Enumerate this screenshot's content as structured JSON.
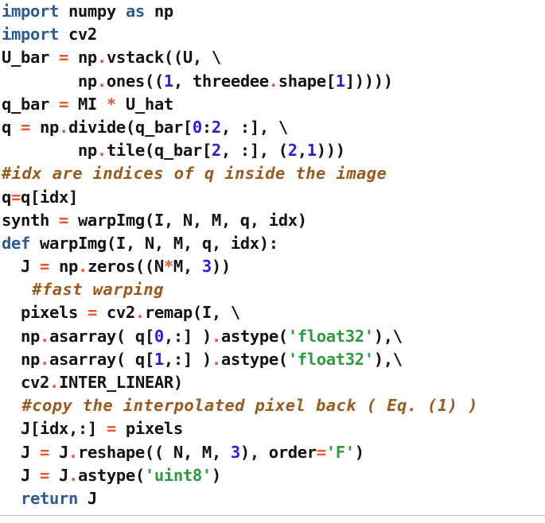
{
  "listing": {
    "language": "python",
    "colors": {
      "background": "#ffffff",
      "default_text": "#131313",
      "keyword": "#2e5b94",
      "operator": "#e8572b",
      "number": "#2b1ddb",
      "string": "#2e9b3f",
      "comment": "#9a5a1c",
      "rule": "#b9b9b9"
    },
    "lines": [
      {
        "n": 1,
        "kind": "code",
        "text": "import numpy as np",
        "tokens": [
          {
            "t": "import",
            "c": "kw"
          },
          {
            "t": " numpy ",
            "c": "plain"
          },
          {
            "t": "as",
            "c": "kw"
          },
          {
            "t": " np",
            "c": "plain"
          }
        ]
      },
      {
        "n": 2,
        "kind": "code",
        "text": "import cv2",
        "tokens": [
          {
            "t": "import",
            "c": "kw"
          },
          {
            "t": " cv2",
            "c": "plain"
          }
        ]
      },
      {
        "n": 3,
        "kind": "code",
        "text": "U_bar = np.vstack((U, \\",
        "tokens": [
          {
            "t": "U_bar ",
            "c": "plain"
          },
          {
            "t": "=",
            "c": "op"
          },
          {
            "t": " np",
            "c": "plain"
          },
          {
            "t": ".",
            "c": "op"
          },
          {
            "t": "vstack((U, \\",
            "c": "plain"
          }
        ]
      },
      {
        "n": 4,
        "kind": "code",
        "text": "        np.ones((1, threedee.shape[1]))))",
        "tokens": [
          {
            "t": "        np",
            "c": "plain"
          },
          {
            "t": ".",
            "c": "op"
          },
          {
            "t": "ones((",
            "c": "plain"
          },
          {
            "t": "1",
            "c": "num"
          },
          {
            "t": ", threedee",
            "c": "plain"
          },
          {
            "t": ".",
            "c": "op"
          },
          {
            "t": "shape[",
            "c": "plain"
          },
          {
            "t": "1",
            "c": "num"
          },
          {
            "t": "]))))",
            "c": "plain"
          }
        ]
      },
      {
        "n": 5,
        "kind": "code",
        "text": "q_bar = MI * U_hat",
        "tokens": [
          {
            "t": "q_bar ",
            "c": "plain"
          },
          {
            "t": "=",
            "c": "op"
          },
          {
            "t": " MI ",
            "c": "plain"
          },
          {
            "t": "*",
            "c": "op"
          },
          {
            "t": " U_hat",
            "c": "plain"
          }
        ]
      },
      {
        "n": 6,
        "kind": "code",
        "text": "q = np.divide(q_bar[0:2, :], \\",
        "tokens": [
          {
            "t": "q ",
            "c": "plain"
          },
          {
            "t": "=",
            "c": "op"
          },
          {
            "t": " np",
            "c": "plain"
          },
          {
            "t": ".",
            "c": "op"
          },
          {
            "t": "divide(q_bar[",
            "c": "plain"
          },
          {
            "t": "0",
            "c": "num"
          },
          {
            "t": ":",
            "c": "plain"
          },
          {
            "t": "2",
            "c": "num"
          },
          {
            "t": ", :], \\",
            "c": "plain"
          }
        ]
      },
      {
        "n": 7,
        "kind": "code",
        "text": "        np.tile(q_bar[2, :], (2,1)))",
        "tokens": [
          {
            "t": "        np",
            "c": "plain"
          },
          {
            "t": ".",
            "c": "op"
          },
          {
            "t": "tile(q_bar[",
            "c": "plain"
          },
          {
            "t": "2",
            "c": "num"
          },
          {
            "t": ", :], (",
            "c": "plain"
          },
          {
            "t": "2",
            "c": "num"
          },
          {
            "t": ",",
            "c": "plain"
          },
          {
            "t": "1",
            "c": "num"
          },
          {
            "t": ")))",
            "c": "plain"
          }
        ]
      },
      {
        "n": 8,
        "kind": "comment",
        "text": "#idx are indices of q inside the image",
        "tokens": [
          {
            "t": "#idx are indices of q inside the image",
            "c": "cmt"
          }
        ]
      },
      {
        "n": 9,
        "kind": "code",
        "text": "q=q[idx]",
        "tokens": [
          {
            "t": "q",
            "c": "plain"
          },
          {
            "t": "=",
            "c": "op"
          },
          {
            "t": "q[idx]",
            "c": "plain"
          }
        ]
      },
      {
        "n": 10,
        "kind": "code",
        "text": "synth = warpImg(I, N, M, q, idx)",
        "tokens": [
          {
            "t": "synth ",
            "c": "plain"
          },
          {
            "t": "=",
            "c": "op"
          },
          {
            "t": " warpImg(I, N, M, q, idx)",
            "c": "plain"
          }
        ]
      },
      {
        "n": 11,
        "kind": "code",
        "text": "def warpImg(I, N, M, q, idx):",
        "tokens": [
          {
            "t": "def",
            "c": "kw"
          },
          {
            "t": " warpImg(I, N, M, q, idx):",
            "c": "plain"
          }
        ]
      },
      {
        "n": 12,
        "kind": "code",
        "text": "  J = np.zeros((N*M, 3))",
        "tokens": [
          {
            "t": "  J ",
            "c": "plain"
          },
          {
            "t": "=",
            "c": "op"
          },
          {
            "t": " np",
            "c": "plain"
          },
          {
            "t": ".",
            "c": "op"
          },
          {
            "t": "zeros((N",
            "c": "plain"
          },
          {
            "t": "*",
            "c": "op"
          },
          {
            "t": "M, ",
            "c": "plain"
          },
          {
            "t": "3",
            "c": "num"
          },
          {
            "t": "))",
            "c": "plain"
          }
        ]
      },
      {
        "n": 13,
        "kind": "comment",
        "text": "   #fast warping",
        "tokens": [
          {
            "t": "   #fast warping",
            "c": "cmt"
          }
        ]
      },
      {
        "n": 14,
        "kind": "code",
        "text": "  pixels = cv2.remap(I, \\",
        "tokens": [
          {
            "t": "  pixels ",
            "c": "plain"
          },
          {
            "t": "=",
            "c": "op"
          },
          {
            "t": " cv2",
            "c": "plain"
          },
          {
            "t": ".",
            "c": "op"
          },
          {
            "t": "remap(I, \\",
            "c": "plain"
          }
        ]
      },
      {
        "n": 15,
        "kind": "code",
        "text": "  np.asarray( q[0,:] ).astype('float32'),\\",
        "tokens": [
          {
            "t": "  np",
            "c": "plain"
          },
          {
            "t": ".",
            "c": "op"
          },
          {
            "t": "asarray( q[",
            "c": "plain"
          },
          {
            "t": "0",
            "c": "num"
          },
          {
            "t": ",:] )",
            "c": "plain"
          },
          {
            "t": ".",
            "c": "op"
          },
          {
            "t": "astype(",
            "c": "plain"
          },
          {
            "t": "'float32'",
            "c": "str"
          },
          {
            "t": "),\\",
            "c": "plain"
          }
        ]
      },
      {
        "n": 16,
        "kind": "code",
        "text": "  np.asarray( q[1,:] ).astype('float32'),\\",
        "tokens": [
          {
            "t": "  np",
            "c": "plain"
          },
          {
            "t": ".",
            "c": "op"
          },
          {
            "t": "asarray( q[",
            "c": "plain"
          },
          {
            "t": "1",
            "c": "num"
          },
          {
            "t": ",:] )",
            "c": "plain"
          },
          {
            "t": ".",
            "c": "op"
          },
          {
            "t": "astype(",
            "c": "plain"
          },
          {
            "t": "'float32'",
            "c": "str"
          },
          {
            "t": "),\\",
            "c": "plain"
          }
        ]
      },
      {
        "n": 17,
        "kind": "code",
        "text": "  cv2.INTER_LINEAR)",
        "tokens": [
          {
            "t": "  cv2",
            "c": "plain"
          },
          {
            "t": ".",
            "c": "op"
          },
          {
            "t": "INTER_LINEAR)",
            "c": "plain"
          }
        ]
      },
      {
        "n": 18,
        "kind": "comment",
        "text": "  #copy the interpolated pixel back ( Eq. (1) )",
        "tokens": [
          {
            "t": "  #copy the interpolated pixel back ( Eq. (1) )",
            "c": "cmt"
          }
        ]
      },
      {
        "n": 19,
        "kind": "code",
        "text": "  J[idx,:] = pixels",
        "tokens": [
          {
            "t": "  J[idx,:] ",
            "c": "plain"
          },
          {
            "t": "=",
            "c": "op"
          },
          {
            "t": " pixels",
            "c": "plain"
          }
        ]
      },
      {
        "n": 20,
        "kind": "code",
        "text": "  J = J.reshape(( N, M, 3), order='F')",
        "tokens": [
          {
            "t": "  J ",
            "c": "plain"
          },
          {
            "t": "=",
            "c": "op"
          },
          {
            "t": " J",
            "c": "plain"
          },
          {
            "t": ".",
            "c": "op"
          },
          {
            "t": "reshape(( N, M, ",
            "c": "plain"
          },
          {
            "t": "3",
            "c": "num"
          },
          {
            "t": "), order",
            "c": "plain"
          },
          {
            "t": "=",
            "c": "op"
          },
          {
            "t": "'F'",
            "c": "str"
          },
          {
            "t": ")",
            "c": "plain"
          }
        ]
      },
      {
        "n": 21,
        "kind": "code",
        "text": "  J = J.astype('uint8')",
        "tokens": [
          {
            "t": "  J ",
            "c": "plain"
          },
          {
            "t": "=",
            "c": "op"
          },
          {
            "t": " J",
            "c": "plain"
          },
          {
            "t": ".",
            "c": "op"
          },
          {
            "t": "astype(",
            "c": "plain"
          },
          {
            "t": "'uint8'",
            "c": "str"
          },
          {
            "t": ")",
            "c": "plain"
          }
        ]
      },
      {
        "n": 22,
        "kind": "code",
        "text": "  return J",
        "tokens": [
          {
            "t": "  ",
            "c": "plain"
          },
          {
            "t": "return",
            "c": "kw"
          },
          {
            "t": " J",
            "c": "plain"
          }
        ]
      }
    ]
  }
}
